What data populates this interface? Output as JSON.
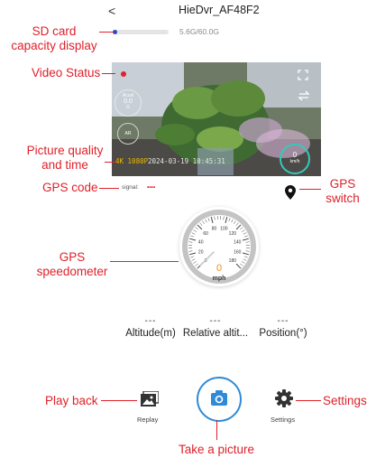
{
  "header": {
    "back_glyph": "<",
    "title": "HieDvr_AF48F2"
  },
  "storage": {
    "used_fraction": 0.08,
    "text": "5.6G/60.0G"
  },
  "video": {
    "accel": {
      "label": "Accel",
      "value": "0.0",
      "unit": "G"
    },
    "ar_label": "AR",
    "speed": {
      "value": "0",
      "unit": "km/h"
    },
    "quality": "4K 1080P",
    "timestamp": "2024-03-19 10:45:31"
  },
  "gps": {
    "signal_label": "signal:",
    "signal_value": "••••"
  },
  "speedometer": {
    "value": "0",
    "unit": "mph",
    "ticks": [
      "0",
      "20",
      "40",
      "60",
      "80",
      "100",
      "120",
      "140",
      "160",
      "180"
    ],
    "needle_value": 0
  },
  "info": [
    {
      "value": "---",
      "label": "Altitude(m)"
    },
    {
      "value": "---",
      "label": "Relative altit..."
    },
    {
      "value": "---",
      "label": "Position(°)"
    }
  ],
  "bottom": {
    "replay_label": "Replay",
    "settings_label": "Settings"
  },
  "annotations": {
    "sd_card": [
      "SD card",
      "capacity display"
    ],
    "video_status": "Video Status",
    "picture_quality": [
      "Picture quality",
      "and time"
    ],
    "gps_code": "GPS code",
    "gps_switch": [
      "GPS",
      "switch"
    ],
    "gps_speedometer": [
      "GPS",
      "speedometer"
    ],
    "play_back": "Play back",
    "settings": "Settings",
    "take_picture": "Take a picture"
  },
  "colors": {
    "annotation_red": "#e0202a",
    "accent_blue": "#2f8ad8",
    "speed_orange": "#f28a1c",
    "quality_yellow": "#f2b800"
  },
  "icons": [
    "back-chevron-icon",
    "fullscreen-icon",
    "switch-camera-icon",
    "location-pin-icon",
    "image-icon",
    "camera-icon",
    "gear-icon"
  ]
}
